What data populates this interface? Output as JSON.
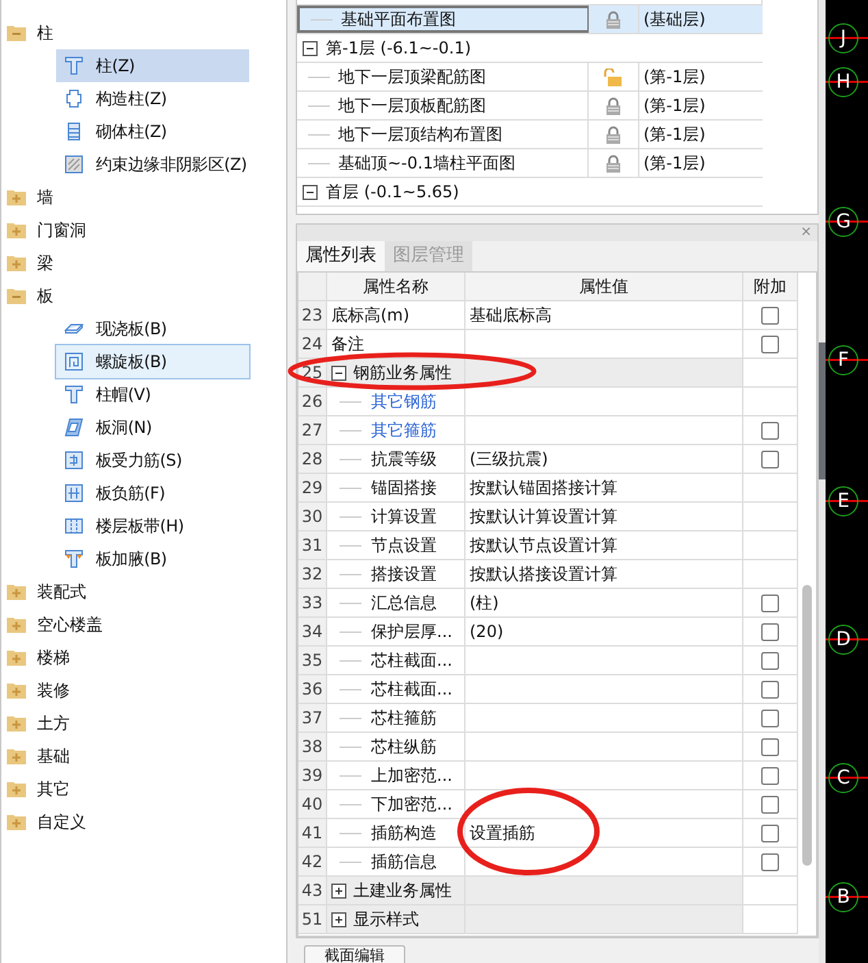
{
  "component_tree": {
    "items": [
      {
        "label": "柱",
        "expanded": true,
        "children": [
          {
            "label": "柱(Z)",
            "kind": "column",
            "selected": true,
            "hovered": false
          },
          {
            "label": "构造柱(Z)",
            "kind": "tiecolumn",
            "selected": false,
            "hovered": false
          },
          {
            "label": "砌体柱(Z)",
            "kind": "masonry",
            "selected": false,
            "hovered": false
          },
          {
            "label": "约束边缘非阴影区(Z)",
            "kind": "hatch",
            "selected": false,
            "hovered": false
          }
        ]
      },
      {
        "label": "墙",
        "expanded": false
      },
      {
        "label": "门窗洞",
        "expanded": false
      },
      {
        "label": "梁",
        "expanded": false
      },
      {
        "label": "板",
        "expanded": true,
        "children": [
          {
            "label": "现浇板(B)",
            "kind": "slab",
            "selected": false,
            "hovered": false
          },
          {
            "label": "螺旋板(B)",
            "kind": "spiral",
            "selected": false,
            "hovered": true
          },
          {
            "label": "柱帽(V)",
            "kind": "column",
            "selected": false,
            "hovered": false
          },
          {
            "label": "板洞(N)",
            "kind": "hole",
            "selected": false,
            "hovered": false
          },
          {
            "label": "板受力筋(S)",
            "kind": "rebar",
            "selected": false,
            "hovered": false
          },
          {
            "label": "板负筋(F)",
            "kind": "negrebar",
            "selected": false,
            "hovered": false
          },
          {
            "label": "楼层板带(H)",
            "kind": "strip",
            "selected": false,
            "hovered": false
          },
          {
            "label": "板加腋(B)",
            "kind": "haunch",
            "selected": false,
            "hovered": false
          }
        ]
      },
      {
        "label": "装配式",
        "expanded": false
      },
      {
        "label": "空心楼盖",
        "expanded": false
      },
      {
        "label": "楼梯",
        "expanded": false
      },
      {
        "label": "装修",
        "expanded": false
      },
      {
        "label": "土方",
        "expanded": false
      },
      {
        "label": "基础",
        "expanded": false
      },
      {
        "label": "其它",
        "expanded": false
      },
      {
        "label": "自定义",
        "expanded": false
      }
    ]
  },
  "drawing_list": {
    "rows": [
      {
        "kind": "drawing",
        "name": "基础平面布置图",
        "locked": true,
        "layer": "(基础层)",
        "selected": true
      },
      {
        "kind": "floor",
        "name": "第-1层 (-6.1~-0.1)",
        "expanded": true
      },
      {
        "kind": "drawing",
        "name": "地下一层顶梁配筋图",
        "locked": false,
        "layer": "(第-1层)",
        "selected": false
      },
      {
        "kind": "drawing",
        "name": "地下一层顶板配筋图",
        "locked": true,
        "layer": "(第-1层)",
        "selected": false
      },
      {
        "kind": "drawing",
        "name": "地下一层顶结构布置图",
        "locked": true,
        "layer": "(第-1层)",
        "selected": false
      },
      {
        "kind": "drawing",
        "name": "基础顶~-0.1墙柱平面图",
        "locked": true,
        "layer": "(第-1层)",
        "selected": false
      },
      {
        "kind": "floor",
        "name": "首层 (-0.1~5.65)",
        "expanded": true
      }
    ]
  },
  "property_panel": {
    "close_symbol": "×",
    "tabs": [
      {
        "label": "属性列表",
        "selected": true
      },
      {
        "label": "图层管理",
        "selected": false
      }
    ],
    "columns": [
      "属性名称",
      "属性值",
      "附加"
    ],
    "rows": [
      {
        "num": "23",
        "kind": "prop",
        "name": "底标高(m)",
        "value": "基础底标高",
        "extra": false
      },
      {
        "num": "24",
        "kind": "prop",
        "name": "备注",
        "extra": false
      },
      {
        "num": "25",
        "kind": "group",
        "name": "钢筋业务属性",
        "expanded": true
      },
      {
        "num": "26",
        "kind": "link",
        "name": "其它钢筋"
      },
      {
        "num": "27",
        "kind": "link",
        "name": "其它箍筋",
        "extra": false
      },
      {
        "num": "28",
        "kind": "child",
        "name": "抗震等级",
        "value": "(三级抗震)",
        "extra": false
      },
      {
        "num": "29",
        "kind": "child",
        "name": "锚固搭接",
        "value": "按默认锚固搭接计算"
      },
      {
        "num": "30",
        "kind": "child",
        "name": "计算设置",
        "value": "按默认计算设置计算"
      },
      {
        "num": "31",
        "kind": "child",
        "name": "节点设置",
        "value": "按默认节点设置计算"
      },
      {
        "num": "32",
        "kind": "child",
        "name": "搭接设置",
        "value": "按默认搭接设置计算"
      },
      {
        "num": "33",
        "kind": "child",
        "name": "汇总信息",
        "value": "(柱)",
        "extra": false
      },
      {
        "num": "34",
        "kind": "child",
        "name": "保护层厚...",
        "value": "(20)",
        "extra": false
      },
      {
        "num": "35",
        "kind": "child",
        "name": "芯柱截面...",
        "extra": false
      },
      {
        "num": "36",
        "kind": "child",
        "name": "芯柱截面...",
        "extra": false
      },
      {
        "num": "37",
        "kind": "child",
        "name": "芯柱箍筋",
        "extra": false
      },
      {
        "num": "38",
        "kind": "child",
        "name": "芯柱纵筋",
        "extra": false
      },
      {
        "num": "39",
        "kind": "child",
        "name": "上加密范...",
        "extra": false
      },
      {
        "num": "40",
        "kind": "child",
        "name": "下加密范...",
        "extra": false
      },
      {
        "num": "41",
        "kind": "child",
        "name": "插筋构造",
        "value": "设置插筋",
        "extra": false
      },
      {
        "num": "42",
        "kind": "child",
        "name": "插筋信息",
        "extra": false
      },
      {
        "num": "43",
        "kind": "group",
        "name": "土建业务属性",
        "expanded": false
      },
      {
        "num": "51",
        "kind": "group",
        "name": "显示样式",
        "expanded": false
      }
    ]
  },
  "buttons": [
    "截面编辑"
  ],
  "axis_labels": [
    "J",
    "H",
    "G",
    "F",
    "E",
    "D",
    "C",
    "B"
  ]
}
